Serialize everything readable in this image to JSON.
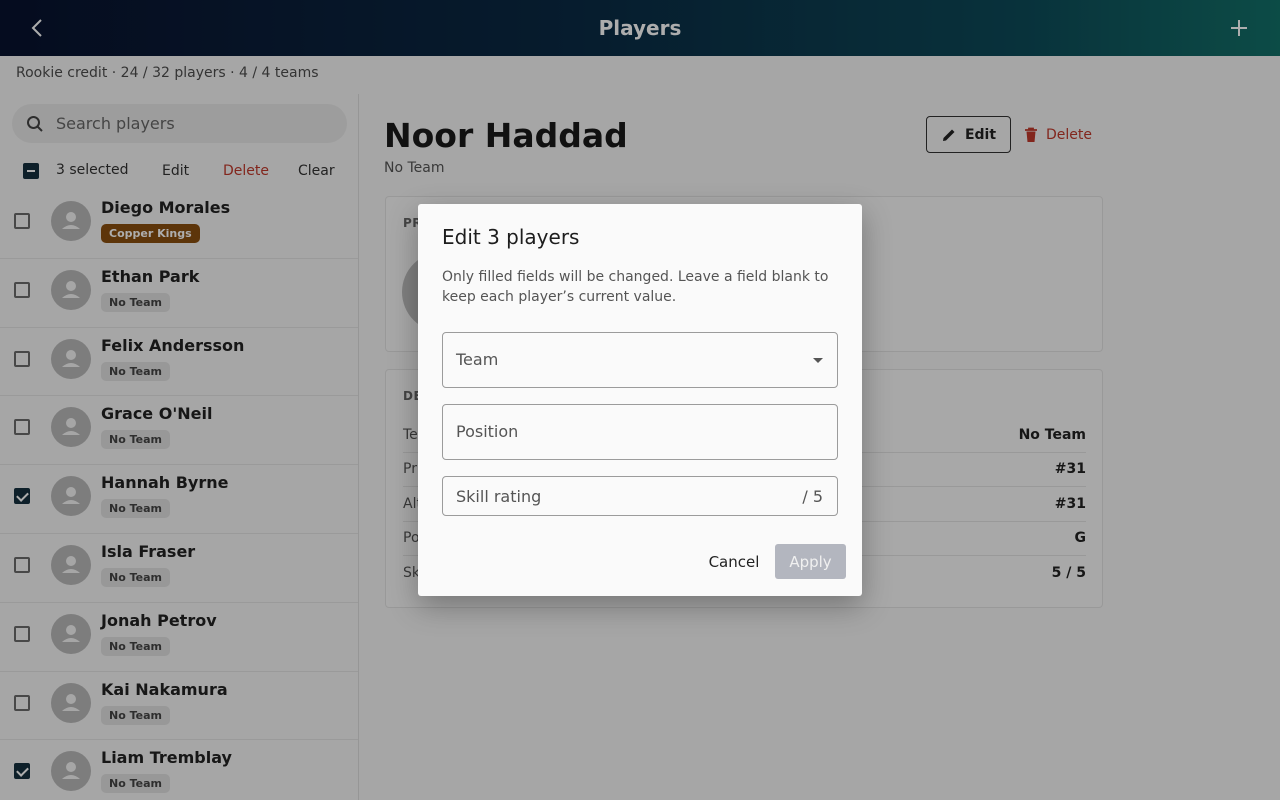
{
  "appbar": {
    "title": "Players",
    "back_icon": "chevron-left-icon",
    "add_icon": "plus-icon"
  },
  "credit_line": "Rookie credit · 24 / 32 players · 4 / 4 teams",
  "search": {
    "placeholder": "Search players"
  },
  "selection": {
    "count_label": "3 selected",
    "edit": "Edit",
    "delete": "Delete",
    "clear": "Clear"
  },
  "players": [
    {
      "name": "Diego Morales",
      "team": "Copper Kings",
      "checked": false
    },
    {
      "name": "Ethan Park",
      "team": "No Team",
      "checked": false
    },
    {
      "name": "Felix Andersson",
      "team": "No Team",
      "checked": false
    },
    {
      "name": "Grace O'Neil",
      "team": "No Team",
      "checked": false
    },
    {
      "name": "Hannah Byrne",
      "team": "No Team",
      "checked": true
    },
    {
      "name": "Isla Fraser",
      "team": "No Team",
      "checked": false
    },
    {
      "name": "Jonah Petrov",
      "team": "No Team",
      "checked": false
    },
    {
      "name": "Kai Nakamura",
      "team": "No Team",
      "checked": false
    },
    {
      "name": "Liam Tremblay",
      "team": "No Team",
      "checked": true
    }
  ],
  "detail": {
    "name": "Noor Haddad",
    "team_sub": "No Team",
    "edit_label": "Edit",
    "delete_label": "Delete",
    "profile_header": "PR",
    "details_header": "DE",
    "rows": [
      {
        "key": "Te",
        "value": "No Team"
      },
      {
        "key": "Pr",
        "value": "#31"
      },
      {
        "key": "Alt",
        "value": "#31"
      },
      {
        "key": "Po",
        "value": "G"
      },
      {
        "key": "Sk",
        "value": "5 / 5"
      }
    ]
  },
  "dialog": {
    "title": "Edit 3 players",
    "description": "Only filled fields will be changed. Leave a field blank to keep each player’s current value.",
    "team_label": "Team",
    "position_label": "Position",
    "skill_label": "Skill rating",
    "skill_suffix": "/ 5",
    "cancel": "Cancel",
    "apply": "Apply"
  },
  "colors": {
    "accent": "#15303f",
    "danger": "#c0392b",
    "copper_badge": "#8a4f0f"
  }
}
